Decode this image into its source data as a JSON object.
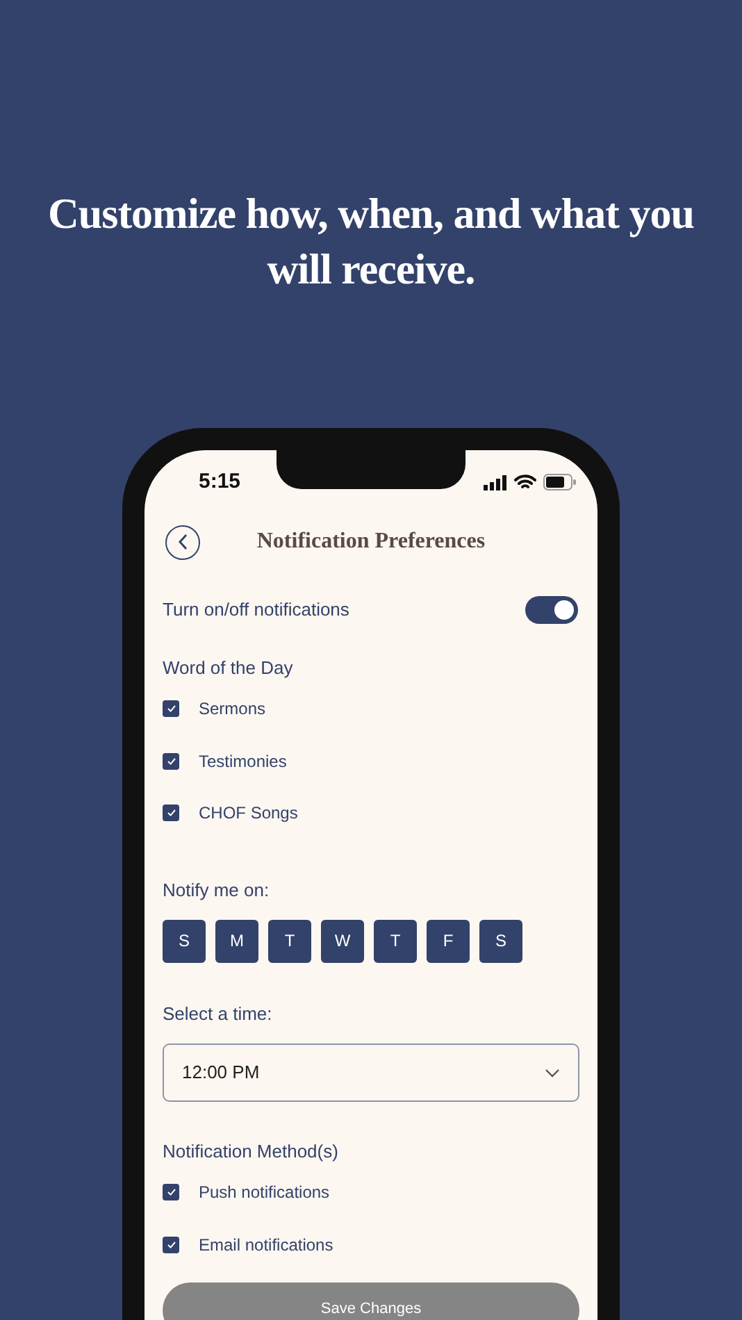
{
  "headline": "Customize how, when, and what you will receive.",
  "status_bar": {
    "time": "5:15"
  },
  "header": {
    "title": "Notification Preferences"
  },
  "master_toggle": {
    "label": "Turn on/off notifications",
    "on": true
  },
  "word_of_the_day": {
    "title": "Word of the Day",
    "options": [
      {
        "label": "Sermons",
        "checked": true
      },
      {
        "label": "Testimonies",
        "checked": true
      },
      {
        "label": "CHOF Songs",
        "checked": true
      }
    ]
  },
  "notify_days": {
    "title": "Notify me on:",
    "days": [
      {
        "label": "S",
        "selected": true
      },
      {
        "label": "M",
        "selected": true
      },
      {
        "label": "T",
        "selected": true
      },
      {
        "label": "W",
        "selected": true
      },
      {
        "label": "T",
        "selected": true
      },
      {
        "label": "F",
        "selected": true
      },
      {
        "label": "S",
        "selected": true
      }
    ]
  },
  "time": {
    "title": "Select a time:",
    "value": "12:00 PM"
  },
  "methods": {
    "title": "Notification Method(s)",
    "options": [
      {
        "label": "Push notifications",
        "checked": true
      },
      {
        "label": "Email notifications",
        "checked": true
      }
    ]
  },
  "save_button": {
    "label": "Save Changes",
    "disabled": true
  }
}
